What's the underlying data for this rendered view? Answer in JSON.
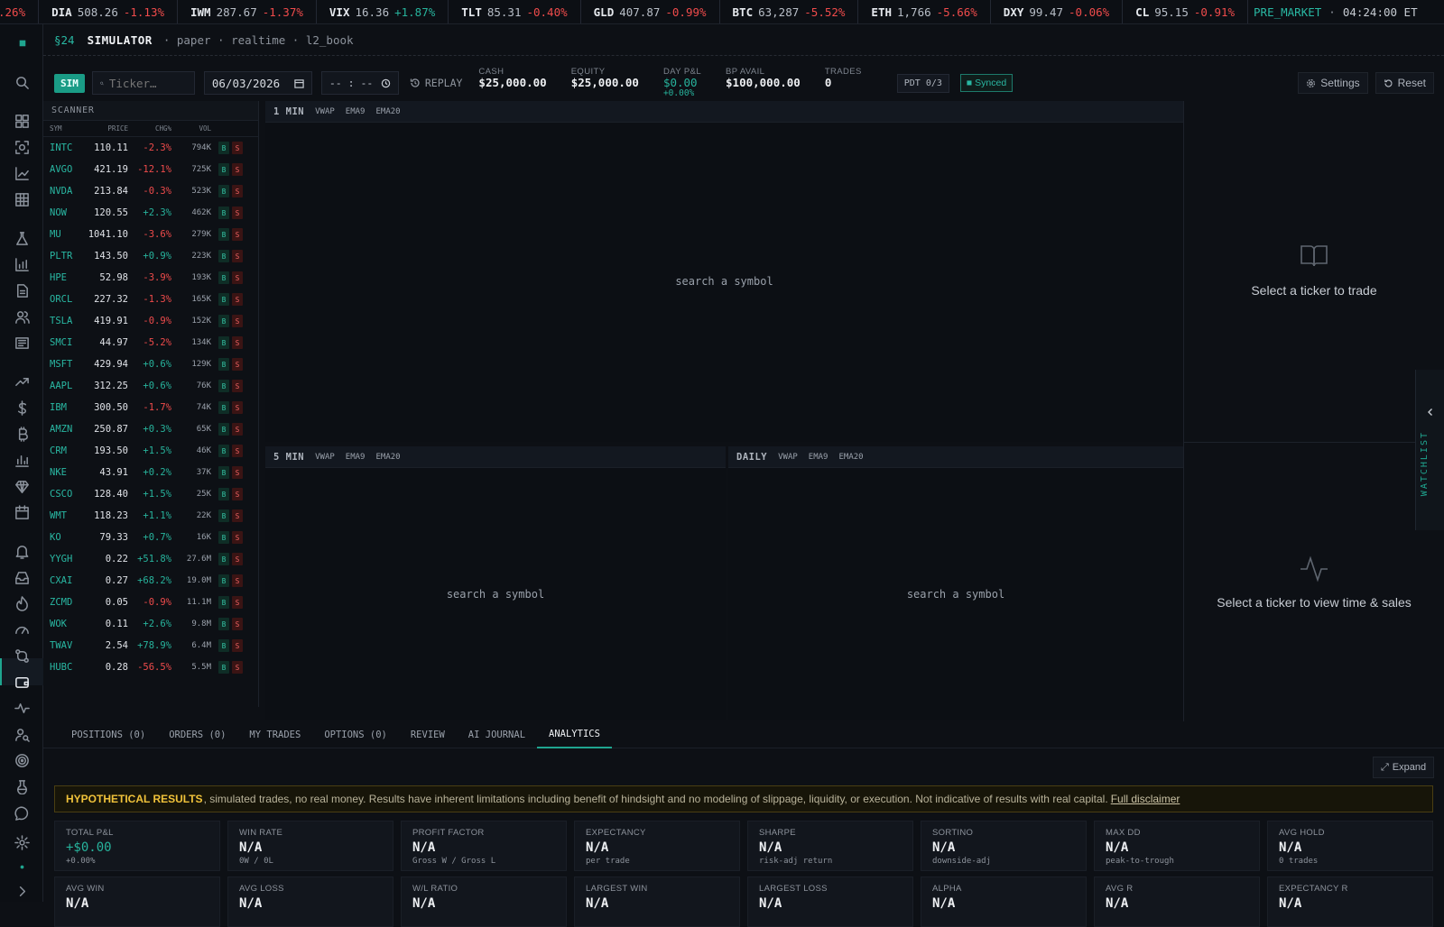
{
  "ticker_tape": [
    {
      "sym": "",
      "price": "",
      "chg": ".26%",
      "dir": "neg"
    },
    {
      "sym": "DIA",
      "price": "508.26",
      "chg": "-1.13%",
      "dir": "neg"
    },
    {
      "sym": "IWM",
      "price": "287.67",
      "chg": "-1.37%",
      "dir": "neg"
    },
    {
      "sym": "VIX",
      "price": "16.36",
      "chg": "+1.87%",
      "dir": "pos"
    },
    {
      "sym": "TLT",
      "price": "85.31",
      "chg": "-0.40%",
      "dir": "neg"
    },
    {
      "sym": "GLD",
      "price": "407.87",
      "chg": "-0.99%",
      "dir": "neg"
    },
    {
      "sym": "BTC",
      "price": "63,287",
      "chg": "-5.52%",
      "dir": "neg"
    },
    {
      "sym": "ETH",
      "price": "1,766",
      "chg": "-5.66%",
      "dir": "neg"
    },
    {
      "sym": "DXY",
      "price": "99.47",
      "chg": "-0.06%",
      "dir": "neg"
    },
    {
      "sym": "CL",
      "price": "95.15",
      "chg": "-0.91%",
      "dir": "neg"
    }
  ],
  "session": "PRE_MARKET",
  "session_sep": "·",
  "clock": "04:24:00 ET",
  "header": {
    "section": "§24",
    "title": "SIMULATOR",
    "subtitle": "· paper · realtime · l2_book"
  },
  "toolbar": {
    "sim_label": "SIM",
    "ticker_placeholder": "Ticker…",
    "date_value": "06/03/2026",
    "time_value": "-- : --",
    "replay_label": "REPLAY",
    "stats": [
      {
        "label": "CASH",
        "value": "$25,000.00"
      },
      {
        "label": "EQUITY",
        "value": "$25,000.00"
      },
      {
        "label": "DAY P&L",
        "value": "$0.00",
        "sub": "+0.00%"
      },
      {
        "label": "BP AVAIL",
        "value": "$100,000.00"
      },
      {
        "label": "TRADES",
        "value": "0"
      }
    ],
    "pdt_label": "PDT 0/3",
    "synced_label": "■ Synced",
    "settings_label": "Settings",
    "reset_label": "Reset"
  },
  "scanner": {
    "title": "SCANNER",
    "columns": [
      "SYM",
      "PRICE",
      "CHG%",
      "VOL"
    ],
    "buy_label": "B",
    "sell_label": "S",
    "rows": [
      {
        "sym": "INTC",
        "price": "110.11",
        "chg": "-2.3%",
        "vol": "794K"
      },
      {
        "sym": "AVGO",
        "price": "421.19",
        "chg": "-12.1%",
        "vol": "725K"
      },
      {
        "sym": "NVDA",
        "price": "213.84",
        "chg": "-0.3%",
        "vol": "523K"
      },
      {
        "sym": "NOW",
        "price": "120.55",
        "chg": "+2.3%",
        "vol": "462K"
      },
      {
        "sym": "MU",
        "price": "1041.10",
        "chg": "-3.6%",
        "vol": "279K"
      },
      {
        "sym": "PLTR",
        "price": "143.50",
        "chg": "+0.9%",
        "vol": "223K"
      },
      {
        "sym": "HPE",
        "price": "52.98",
        "chg": "-3.9%",
        "vol": "193K"
      },
      {
        "sym": "ORCL",
        "price": "227.32",
        "chg": "-1.3%",
        "vol": "165K"
      },
      {
        "sym": "TSLA",
        "price": "419.91",
        "chg": "-0.9%",
        "vol": "152K"
      },
      {
        "sym": "SMCI",
        "price": "44.97",
        "chg": "-5.2%",
        "vol": "134K"
      },
      {
        "sym": "MSFT",
        "price": "429.94",
        "chg": "+0.6%",
        "vol": "129K"
      },
      {
        "sym": "AAPL",
        "price": "312.25",
        "chg": "+0.6%",
        "vol": "76K"
      },
      {
        "sym": "IBM",
        "price": "300.50",
        "chg": "-1.7%",
        "vol": "74K"
      },
      {
        "sym": "AMZN",
        "price": "250.87",
        "chg": "+0.3%",
        "vol": "65K"
      },
      {
        "sym": "CRM",
        "price": "193.50",
        "chg": "+1.5%",
        "vol": "46K"
      },
      {
        "sym": "NKE",
        "price": "43.91",
        "chg": "+0.2%",
        "vol": "37K"
      },
      {
        "sym": "CSCO",
        "price": "128.40",
        "chg": "+1.5%",
        "vol": "25K"
      },
      {
        "sym": "WMT",
        "price": "118.23",
        "chg": "+1.1%",
        "vol": "22K"
      },
      {
        "sym": "KO",
        "price": "79.33",
        "chg": "+0.7%",
        "vol": "16K"
      },
      {
        "sym": "YYGH",
        "price": "0.22",
        "chg": "+51.8%",
        "vol": "27.6M"
      },
      {
        "sym": "CXAI",
        "price": "0.27",
        "chg": "+68.2%",
        "vol": "19.0M"
      },
      {
        "sym": "ZCMD",
        "price": "0.05",
        "chg": "-0.9%",
        "vol": "11.1M"
      },
      {
        "sym": "WOK",
        "price": "0.11",
        "chg": "+2.6%",
        "vol": "9.8M"
      },
      {
        "sym": "TWAV",
        "price": "2.54",
        "chg": "+78.9%",
        "vol": "6.4M"
      },
      {
        "sym": "HUBC",
        "price": "0.28",
        "chg": "-56.5%",
        "vol": "5.5M"
      }
    ]
  },
  "charts": {
    "main": {
      "title": "1 MIN",
      "placeholder": "search a symbol"
    },
    "five": {
      "title": "5 MIN",
      "placeholder": "search a symbol"
    },
    "daily": {
      "title": "DAILY",
      "placeholder": "search a symbol"
    },
    "indicators": [
      "VWAP",
      "EMA9",
      "EMA20"
    ]
  },
  "right": {
    "trade_msg": "Select a ticker to trade",
    "tns_msg": "Select a ticker to view time & sales",
    "watchlist_label": "WATCHLIST"
  },
  "tabs": [
    {
      "label": "POSITIONS (0)"
    },
    {
      "label": "ORDERS (0)"
    },
    {
      "label": "MY TRADES"
    },
    {
      "label": "OPTIONS (0)"
    },
    {
      "label": "REVIEW"
    },
    {
      "label": "AI JOURNAL"
    },
    {
      "label": "ANALYTICS",
      "active": true
    }
  ],
  "expand_label": "Expand",
  "disclaimer": {
    "title": "HYPOTHETICAL RESULTS",
    "text": ", simulated trades, no real money. Results have inherent limitations including benefit of hindsight and no modeling of slippage, liquidity, or execution. Not indicative of results with real capital.",
    "link": "Full disclaimer"
  },
  "metrics": [
    {
      "label": "TOTAL P&L",
      "value": "+$0.00",
      "sub": "+0.00%",
      "green": true
    },
    {
      "label": "WIN RATE",
      "value": "N/A",
      "sub": "0W / 0L"
    },
    {
      "label": "PROFIT FACTOR",
      "value": "N/A",
      "sub": "Gross W / Gross L"
    },
    {
      "label": "EXPECTANCY",
      "value": "N/A",
      "sub": "per trade"
    },
    {
      "label": "SHARPE",
      "value": "N/A",
      "sub": "risk-adj return"
    },
    {
      "label": "SORTINO",
      "value": "N/A",
      "sub": "downside-adj"
    },
    {
      "label": "MAX DD",
      "value": "N/A",
      "sub": "peak-to-trough"
    },
    {
      "label": "AVG HOLD",
      "value": "N/A",
      "sub": "0 trades"
    },
    {
      "label": "AVG WIN",
      "value": "N/A",
      "sub": ""
    },
    {
      "label": "AVG LOSS",
      "value": "N/A",
      "sub": ""
    },
    {
      "label": "W/L RATIO",
      "value": "N/A",
      "sub": ""
    },
    {
      "label": "LARGEST WIN",
      "value": "N/A",
      "sub": ""
    },
    {
      "label": "LARGEST LOSS",
      "value": "N/A",
      "sub": ""
    },
    {
      "label": "ALPHA",
      "value": "N/A",
      "sub": ""
    },
    {
      "label": "AVG R",
      "value": "N/A",
      "sub": ""
    },
    {
      "label": "EXPECTANCY R",
      "value": "N/A",
      "sub": ""
    }
  ],
  "colors": {
    "accent": "#1fa58f",
    "neg": "#ef4b4b",
    "pos": "#27b39c",
    "warn": "#f0c23a"
  }
}
